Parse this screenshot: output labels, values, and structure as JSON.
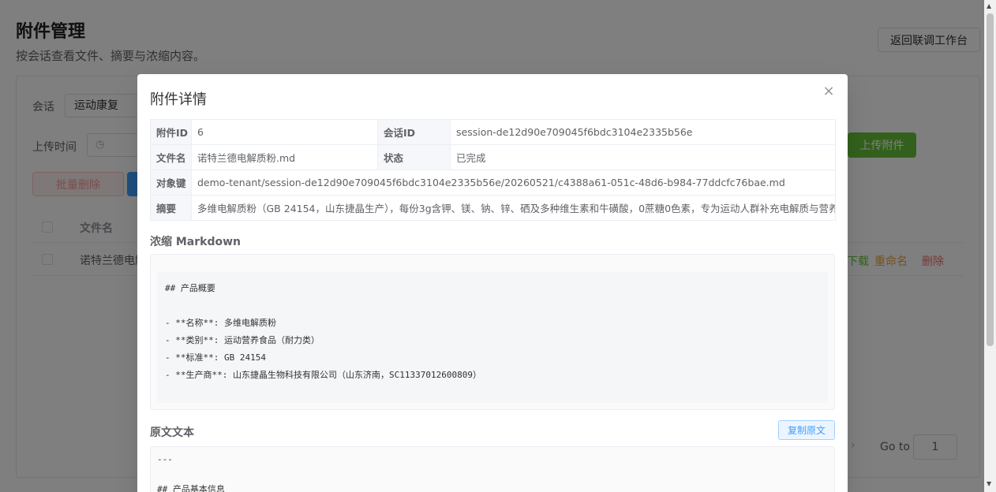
{
  "page": {
    "title": "附件管理",
    "subtitle": "按会话查看文件、摘要与浓缩内容。",
    "back_button": "返回联调工作台"
  },
  "filters": {
    "session_label": "会话",
    "session_value": "运动康复",
    "upload_time_label": "上传时间",
    "clock_icon": "◷",
    "upload_button": "上传附件",
    "batch_delete_button": "批量删除"
  },
  "table": {
    "col_filename": "文件名",
    "rows": [
      {
        "filename": "诺特兰德电解"
      }
    ],
    "actions": {
      "download": "下载",
      "rename": "重命名",
      "delete": "删除"
    }
  },
  "pagination": {
    "goto_label": "Go to",
    "page": "1",
    "next_icon": "›"
  },
  "dialog": {
    "title": "附件详情",
    "close_icon": "×",
    "fields": {
      "attachment_id_label": "附件ID",
      "attachment_id": "6",
      "session_id_label": "会话ID",
      "session_id": "session-de12d90e709045f6bdc3104e2335b56e",
      "filename_label": "文件名",
      "filename": "诺特兰德电解质粉.md",
      "status_label": "状态",
      "status": "已完成",
      "object_key_label": "对象键",
      "object_key": "demo-tenant/session-de12d90e709045f6bdc3104e2335b56e/20260521/c4388a61-051c-48d6-b984-77ddcfc76bae.md",
      "summary_label": "摘要",
      "summary": "多维电解质粉（GB 24154，山东捷晶生产），每份3g含钾、镁、钠、锌、硒及多种维生素和牛磺酸，0蔗糖0色素，专为运动人群补充电解质与营养。"
    },
    "markdown_title": "浓缩 Markdown",
    "markdown_content": "## 产品概要\n\n- **名称**: 多维电解质粉\n- **类别**: 运动营养食品（耐力类）\n- **标准**: GB 24154\n- **生产商**: 山东捷晶生物科技有限公司（山东济南，SC11337012600809）",
    "raw_title": "原文文本",
    "copy_button": "复制原文",
    "raw_content": "---\n\n## 产品基本信息"
  }
}
